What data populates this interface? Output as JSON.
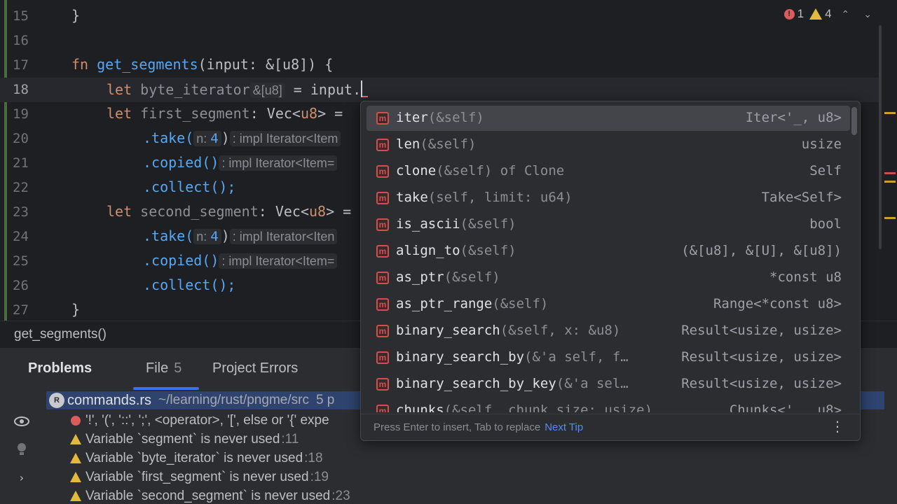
{
  "editor": {
    "lines": [
      {
        "n": "15",
        "code": "}"
      },
      {
        "n": "16",
        "code": ""
      },
      {
        "n": "17",
        "kw": "fn",
        "name": "get_segments",
        "params": "(input: &[u8]) {"
      },
      {
        "n": "18",
        "let": "let",
        "var": "byte_iterator",
        "hint": "&[u8]",
        "rest": " = input."
      },
      {
        "n": "19",
        "let": "let",
        "var": "first_segment",
        "rest": ": Vec<",
        "ty": "u8",
        "rest2": "> = "
      },
      {
        "n": "20",
        "method": ".take(",
        "hint_name": "n:",
        "hint_val": "4",
        "close": ")",
        "hint2": ": impl Iterator<Item"
      },
      {
        "n": "21",
        "method": ".copied()",
        "hint2": ": impl Iterator<Item="
      },
      {
        "n": "22",
        "method": ".collect();"
      },
      {
        "n": "23",
        "let": "let",
        "var": "second_segment",
        "rest": ": Vec<",
        "ty": "u8",
        "rest2": "> ="
      },
      {
        "n": "24",
        "method": ".take(",
        "hint_name": "n:",
        "hint_val": "4",
        "close": ")",
        "hint2": ": impl Iterator<Iten"
      },
      {
        "n": "25",
        "method": ".copied()",
        "hint2": ": impl Iterator<Item="
      },
      {
        "n": "26",
        "method": ".collect();"
      },
      {
        "n": "27",
        "code": "}"
      }
    ]
  },
  "inspections": {
    "errors": "1",
    "warnings": "4",
    "up": "⌃",
    "down": "⌄"
  },
  "breadcrumb": "get_segments()",
  "completion": {
    "items": [
      {
        "name": "iter",
        "tail": "(&self)",
        "type": "Iter<'_, u8>"
      },
      {
        "name": "len",
        "tail": "(&self)",
        "type": "usize"
      },
      {
        "name": "clone",
        "tail": "(&self) of Clone",
        "type": "Self"
      },
      {
        "name": "take",
        "tail": "(self, limit: u64)",
        "type": "Take<Self>"
      },
      {
        "name": "is_ascii",
        "tail": "(&self)",
        "type": "bool"
      },
      {
        "name": "align_to",
        "tail": "(&self)",
        "type": "(&[u8], &[U], &[u8])"
      },
      {
        "name": "as_ptr",
        "tail": "(&self)",
        "type": "*const u8"
      },
      {
        "name": "as_ptr_range",
        "tail": "(&self)",
        "type": "Range<*const u8>"
      },
      {
        "name": "binary_search",
        "tail": "(&self, x: &u8)",
        "type": "Result<usize, usize>"
      },
      {
        "name": "binary_search_by",
        "tail": "(&'a self, f…",
        "type": "Result<usize, usize>"
      },
      {
        "name": "binary_search_by_key",
        "tail": "(&'a sel…",
        "type": "Result<usize, usize>"
      },
      {
        "name": "chunks",
        "tail": "(&self, chunk_size: usize)",
        "type": "Chunks<'_, u8>"
      }
    ],
    "icon_letter": "m",
    "footer_tip": "Press Enter to insert, Tab to replace",
    "next_tip": "Next Tip",
    "more": "⋮"
  },
  "problems": {
    "tabs": [
      {
        "label": "Problems",
        "count": ""
      },
      {
        "label": "File",
        "count": "5"
      },
      {
        "label": "Project Errors",
        "count": ""
      }
    ],
    "file": {
      "icon": "R",
      "name": "commands.rs",
      "path": "~/learning/rust/pngme/src",
      "count": "5 p"
    },
    "rows": [
      {
        "kind": "error",
        "text": "'!', '(', '::', ';', <operator>, '[', else or '{' expe",
        "loc": ""
      },
      {
        "kind": "warning",
        "text": "Variable `segment` is never used",
        "loc": ":11"
      },
      {
        "kind": "warning",
        "text": "Variable `byte_iterator` is never used",
        "loc": ":18"
      },
      {
        "kind": "warning",
        "text": "Variable `first_segment` is never used",
        "loc": ":19"
      },
      {
        "kind": "warning",
        "text": "Variable `second_segment` is never used",
        "loc": ":23"
      }
    ]
  },
  "colors": {
    "accent": "#3574f0",
    "error": "#db5c5c",
    "warning": "#e2b93d",
    "method_icon": "#d54e4e"
  }
}
